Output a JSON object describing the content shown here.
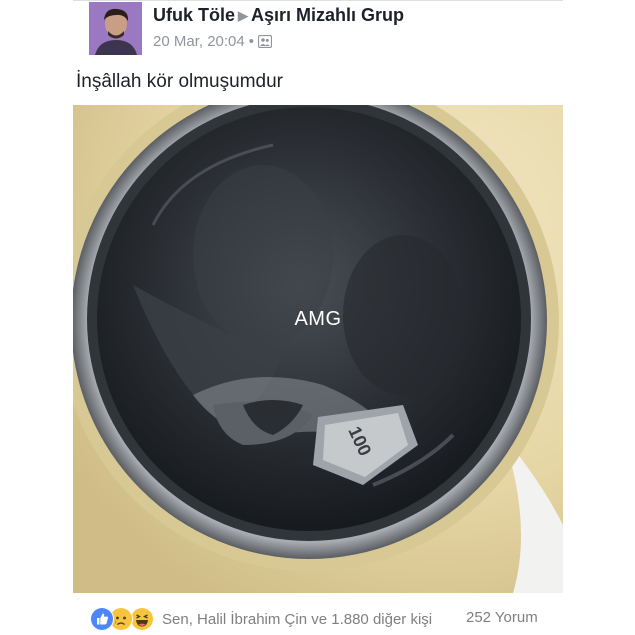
{
  "post": {
    "author": "Ufuk Töle",
    "group": "Aşırı Mizahlı Grup",
    "timestamp": "20 Mar, 20:04",
    "separator": "•",
    "privacy_icon": "group-privacy-icon",
    "text": "İnşâllah kör olmuşumdur"
  },
  "photo": {
    "watermark": "AMG",
    "banknote_text": "100",
    "alt_subject": "washing-machine-door"
  },
  "footer": {
    "reaction_icons": [
      "like-icon",
      "sad-icon",
      "haha-icon"
    ],
    "reactions_text": "Sen, Halil İbrahim Çin ve 1.880 diğer kişi",
    "comments_text": "252 Yorum"
  },
  "colors": {
    "text": "#1d2129",
    "meta": "#90949c",
    "like_blue": "#4e86f7",
    "emoji_yellow": "#f7c43d",
    "machine_cream": "#e8d9a8"
  }
}
